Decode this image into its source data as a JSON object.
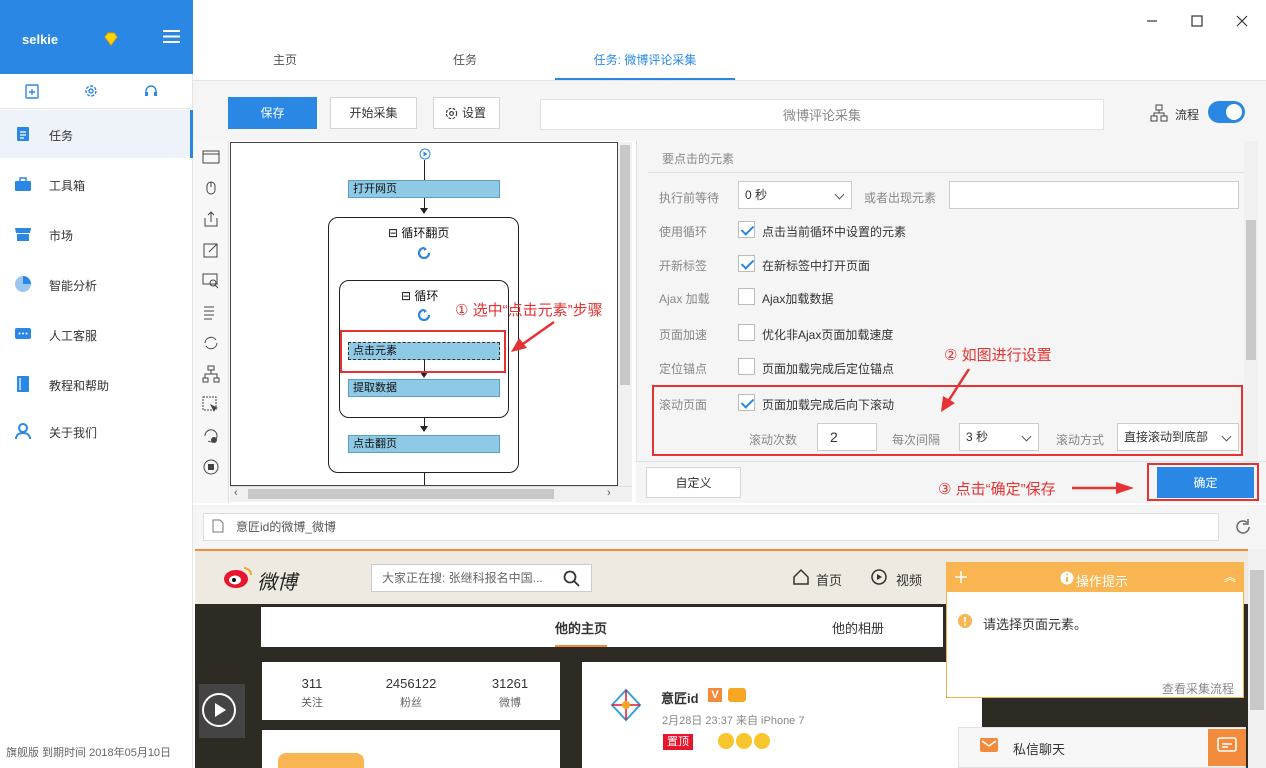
{
  "sidebar": {
    "user": "selkie",
    "nav": [
      {
        "label": "任务",
        "icon": "task-icon"
      },
      {
        "label": "工具箱",
        "icon": "toolbox-icon"
      },
      {
        "label": "市场",
        "icon": "market-icon"
      },
      {
        "label": "智能分析",
        "icon": "pie-chart-icon"
      },
      {
        "label": "人工客服",
        "icon": "chat-icon"
      },
      {
        "label": "教程和帮助",
        "icon": "book-icon"
      },
      {
        "label": "关于我们",
        "icon": "user-icon"
      }
    ],
    "footer": "旗舰版  到期时间  2018年05月10日"
  },
  "tabs": [
    {
      "label": "主页"
    },
    {
      "label": "任务"
    },
    {
      "label": "任务: 微博评论采集"
    }
  ],
  "toolbar": {
    "save": "保存",
    "start": "开始采集",
    "settings": "设置",
    "task_name": "微博评论采集",
    "flow_label": "流程"
  },
  "flow": {
    "open_page": "打开网页",
    "loop_page": "循环翻页",
    "loop": "循环",
    "click_element": "点击元素",
    "extract": "提取数据",
    "click_next": "点击翻页"
  },
  "settings": {
    "section_title": "要点击的元素",
    "wait_label": "执行前等待",
    "wait_value": "0 秒",
    "or_appear_label": "或者出现元素",
    "use_loop_label": "使用循环",
    "use_loop_text": "点击当前循环中设置的元素",
    "new_tab_label": "开新标签",
    "new_tab_text": "在新标签中打开页面",
    "ajax_label": "Ajax 加载",
    "ajax_text": "Ajax加载数据",
    "speed_label": "页面加速",
    "speed_text": "优化非Ajax页面加载速度",
    "anchor_label": "定位锚点",
    "anchor_text": "页面加载完成后定位锚点",
    "scroll_label": "滚动页面",
    "scroll_text": "页面加载完成后向下滚动",
    "scroll_count_label": "滚动次数",
    "scroll_count": "2",
    "interval_label": "每次间隔",
    "interval_value": "3 秒",
    "mode_label": "滚动方式",
    "mode_value": "直接滚动到底部",
    "custom_btn": "自定义",
    "ok_btn": "确定"
  },
  "annotations": {
    "a1": "① 选中“点击元素”步骤",
    "a2": "② 如图进行设置",
    "a3": "③ 点击“确定”保存"
  },
  "browser": {
    "url": "意匠id的微博_微博",
    "logo_text": "微博",
    "search_placeholder": "大家正在搜: 张继科报名中国...",
    "nav_home": "首页",
    "nav_video": "视频",
    "tab_home": "他的主页",
    "tab_album": "他的相册",
    "stats": [
      {
        "num": "311",
        "label": "关注"
      },
      {
        "num": "2456122",
        "label": "粉丝"
      },
      {
        "num": "31261",
        "label": "微博"
      }
    ],
    "post_user": "意匠id",
    "post_meta": "2月28日 23:37 来自 iPhone 7",
    "post_tag": "置顶"
  },
  "popup": {
    "title": "操作提示",
    "message": "请选择页面元素。",
    "link": "查看采集流程"
  },
  "chat": {
    "label": "私信聊天"
  },
  "colors": {
    "accent": "#2a88e4",
    "annotation": "#e63232",
    "step": "#8ecae6"
  }
}
